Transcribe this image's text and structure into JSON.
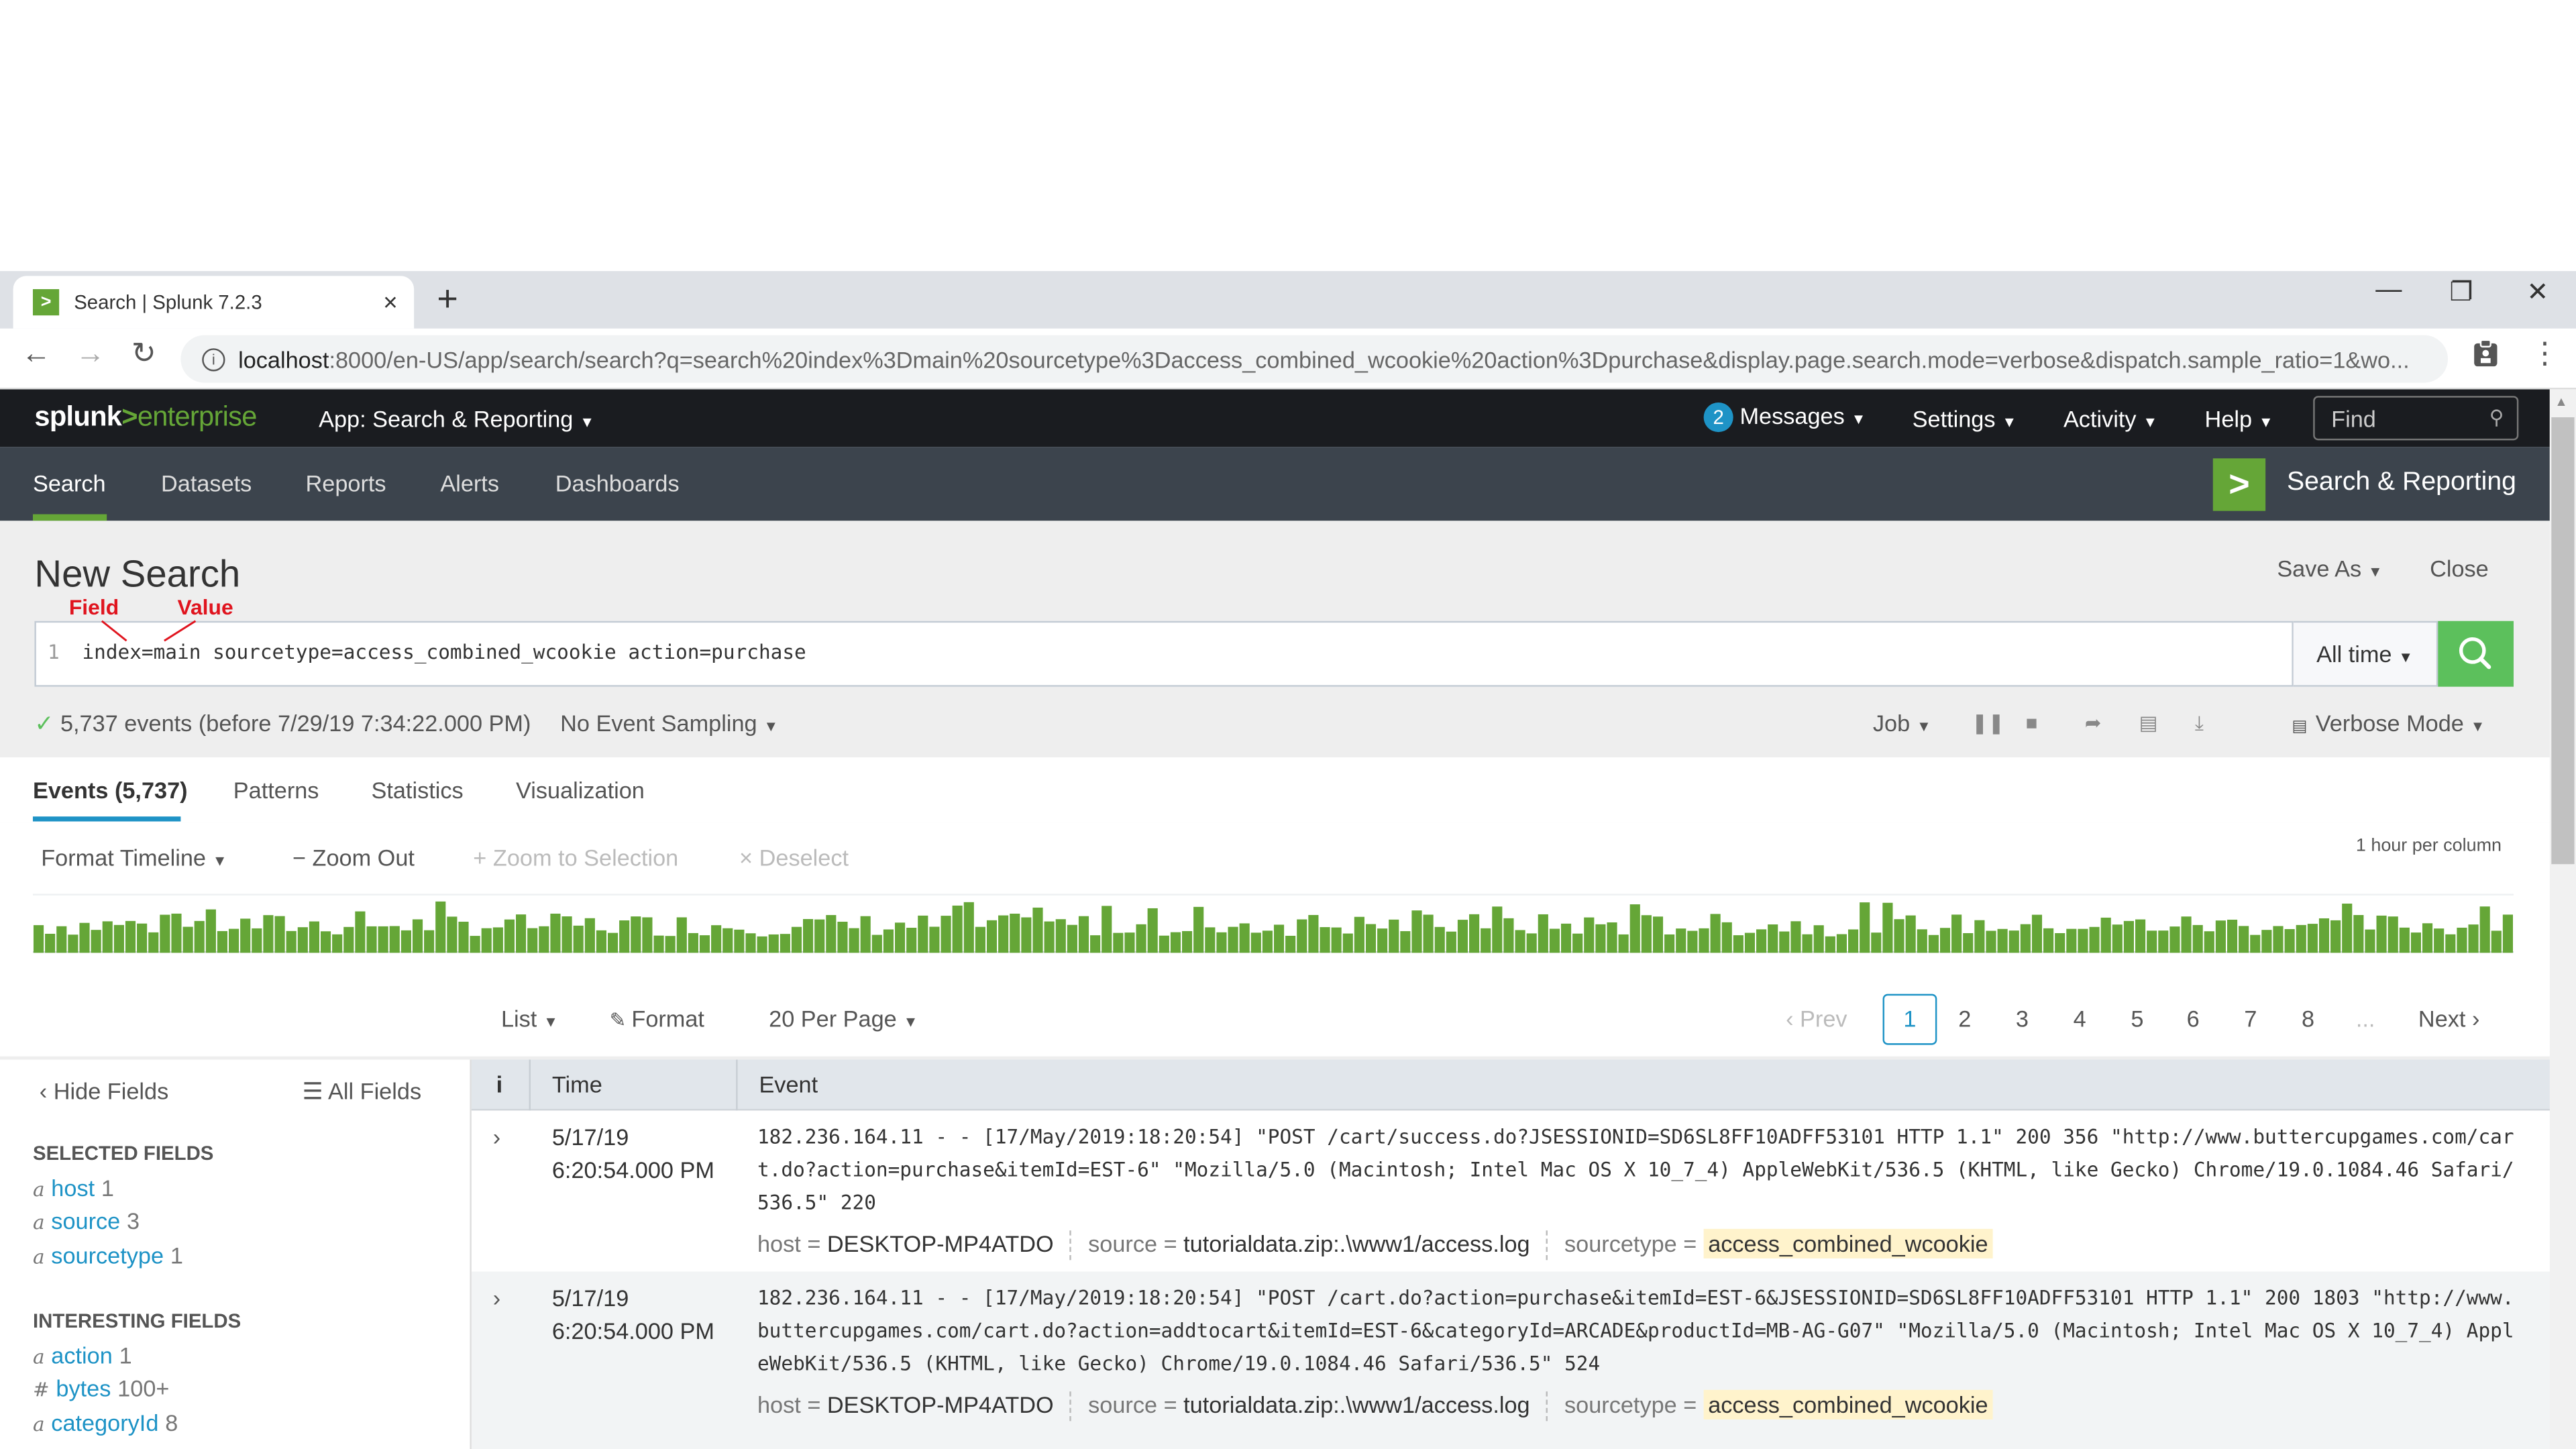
{
  "browser": {
    "tab_title": "Search | Splunk 7.2.3",
    "tab_close": "×",
    "new_tab": "+",
    "url_host": "localhost",
    "url_rest": ":8000/en-US/app/search/search?q=search%20index%3Dmain%20sourcetype%3Daccess_combined_wcookie%20action%3Dpurchase&display.page.search.mode=verbose&dispatch.sample_ratio=1&wo..."
  },
  "topbar": {
    "logo_a": "splunk",
    "logo_arrow": ">",
    "logo_b": "enterprise",
    "app_menu": "App: Search & Reporting",
    "messages_count": "2",
    "messages": "Messages",
    "settings": "Settings",
    "activity": "Activity",
    "help": "Help",
    "find_placeholder": "Find"
  },
  "nav": {
    "items": [
      "Search",
      "Datasets",
      "Reports",
      "Alerts",
      "Dashboards"
    ],
    "app_name": "Search & Reporting"
  },
  "page": {
    "title": "New Search",
    "save_as": "Save As",
    "close": "Close"
  },
  "annotations": {
    "field": "Field",
    "value": "Value"
  },
  "search": {
    "line_number": "1",
    "query": "index=main sourcetype=access_combined_wcookie action=purchase",
    "time_range": "All time"
  },
  "status": {
    "events_text": "5,737 events (before 7/29/19 7:34:22.000 PM)",
    "sampling": "No Event Sampling",
    "job": "Job",
    "mode": "Verbose Mode"
  },
  "results_tabs": [
    "Events (5,737)",
    "Patterns",
    "Statistics",
    "Visualization"
  ],
  "timeline": {
    "format": "Format Timeline",
    "zoom_out": "Zoom Out",
    "zoom_selection": "Zoom to Selection",
    "deselect": "Deselect",
    "scale": "1 hour per column",
    "bar_color": "#65a637"
  },
  "list_controls": {
    "list": "List",
    "format": "Format",
    "per_page": "20 Per Page"
  },
  "pagination": {
    "prev": "Prev",
    "pages": [
      "1",
      "2",
      "3",
      "4",
      "5",
      "6",
      "7",
      "8"
    ],
    "ellipsis": "...",
    "next": "Next",
    "current": "1"
  },
  "fields": {
    "hide": "Hide Fields",
    "all": "All Fields",
    "selected_heading": "SELECTED FIELDS",
    "selected": [
      {
        "type": "a",
        "name": "host",
        "count": "1"
      },
      {
        "type": "a",
        "name": "source",
        "count": "3"
      },
      {
        "type": "a",
        "name": "sourcetype",
        "count": "1"
      }
    ],
    "interesting_heading": "INTERESTING FIELDS",
    "interesting": [
      {
        "type": "a",
        "name": "action",
        "count": "1"
      },
      {
        "type": "#",
        "name": "bytes",
        "count": "100+"
      },
      {
        "type": "a",
        "name": "categoryId",
        "count": "8"
      }
    ]
  },
  "table": {
    "col_info": "i",
    "col_time": "Time",
    "col_event": "Event",
    "rows": [
      {
        "date": "5/17/19",
        "time": "6:20:54.000 PM",
        "raw": "182.236.164.11 - - [17/May/2019:18:20:54] \"POST /cart/success.do?JSESSIONID=SD6SL8FF10ADFF53101 HTTP 1.1\" 200 356 \"http://www.buttercupgames.com/cart.do?action=purchase&itemId=EST-6\" \"Mozilla/5.0 (Macintosh; Intel Mac OS X 10_7_4) AppleWebKit/536.5 (KHTML, like Gecko) Chrome/19.0.1084.46 Safari/536.5\" 220",
        "host_label": "host =",
        "host": "DESKTOP-MP4ATDO",
        "source_label": "source =",
        "source": "tutorialdata.zip:.\\www1/access.log",
        "sourcetype_label": "sourcetype =",
        "sourcetype": "access_combined_wcookie"
      },
      {
        "date": "5/17/19",
        "time": "6:20:54.000 PM",
        "raw": "182.236.164.11 - - [17/May/2019:18:20:54] \"POST /cart.do?action=purchase&itemId=EST-6&JSESSIONID=SD6SL8FF10ADFF53101 HTTP 1.1\" 200 1803 \"http://www.buttercupgames.com/cart.do?action=addtocart&itemId=EST-6&categoryId=ARCADE&productId=MB-AG-G07\" \"Mozilla/5.0 (Macintosh; Intel Mac OS X 10_7_4) AppleWebKit/536.5 (KHTML, like Gecko) Chrome/19.0.1084.46 Safari/536.5\" 524",
        "host_label": "host =",
        "host": "DESKTOP-MP4ATDO",
        "source_label": "source =",
        "source": "tutorialdata.zip:.\\www1/access.log",
        "sourcetype_label": "sourcetype =",
        "sourcetype": "access_combined_wcookie"
      }
    ]
  }
}
